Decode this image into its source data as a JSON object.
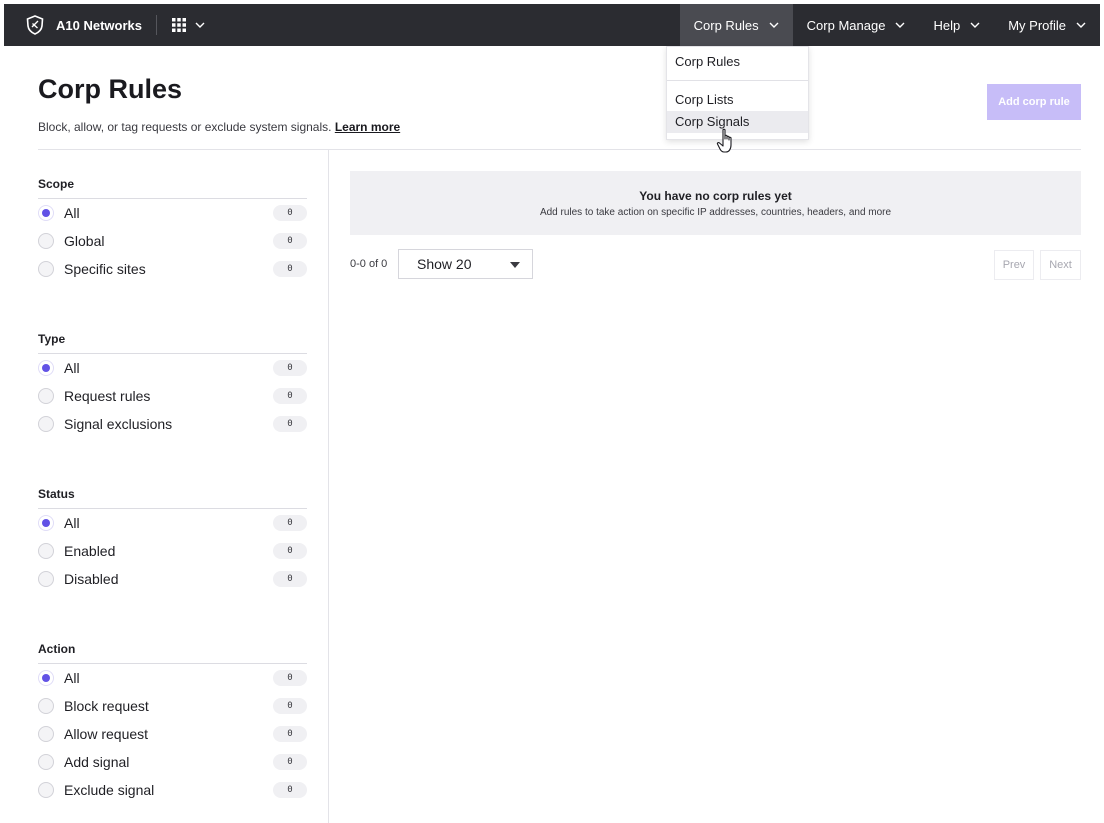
{
  "brand": {
    "name": "A10 Networks",
    "logo_icon": "shield-logo-icon",
    "apps_icon": "grid-icon"
  },
  "nav": {
    "items": [
      {
        "label": "Corp Rules",
        "active": true
      },
      {
        "label": "Corp Manage",
        "active": false
      },
      {
        "label": "Help",
        "active": false
      },
      {
        "label": "My Profile",
        "active": false
      }
    ]
  },
  "dropdown": {
    "items": [
      "Corp Rules",
      "Corp Lists",
      "Corp Signals"
    ],
    "hovered": "Corp Signals"
  },
  "header": {
    "title": "Corp Rules",
    "description": "Block, allow, or tag requests or exclude system signals.",
    "learn_more": "Learn more",
    "add_button": "Add corp rule"
  },
  "filters": {
    "scope": {
      "title": "Scope",
      "options": [
        {
          "label": "All",
          "count": "0",
          "checked": true
        },
        {
          "label": "Global",
          "count": "0",
          "checked": false
        },
        {
          "label": "Specific sites",
          "count": "0",
          "checked": false
        }
      ]
    },
    "type": {
      "title": "Type",
      "options": [
        {
          "label": "All",
          "count": "0",
          "checked": true
        },
        {
          "label": "Request rules",
          "count": "0",
          "checked": false
        },
        {
          "label": "Signal exclusions",
          "count": "0",
          "checked": false
        }
      ]
    },
    "status": {
      "title": "Status",
      "options": [
        {
          "label": "All",
          "count": "0",
          "checked": true
        },
        {
          "label": "Enabled",
          "count": "0",
          "checked": false
        },
        {
          "label": "Disabled",
          "count": "0",
          "checked": false
        }
      ]
    },
    "action": {
      "title": "Action",
      "options": [
        {
          "label": "All",
          "count": "0",
          "checked": true
        },
        {
          "label": "Block request",
          "count": "0",
          "checked": false
        },
        {
          "label": "Allow request",
          "count": "0",
          "checked": false
        },
        {
          "label": "Add signal",
          "count": "0",
          "checked": false
        },
        {
          "label": "Exclude signal",
          "count": "0",
          "checked": false
        }
      ]
    }
  },
  "empty_state": {
    "title": "You have no corp rules yet",
    "subtitle": "Add rules to take action on specific IP addresses, countries, headers, and more"
  },
  "pagination": {
    "range": "0-0 of 0",
    "page_size": "Show 20",
    "prev": "Prev",
    "next": "Next"
  },
  "colors": {
    "nav_bg": "#2b2c31",
    "accent": "#6252e6",
    "add_button_bg": "#c7bdf8"
  }
}
